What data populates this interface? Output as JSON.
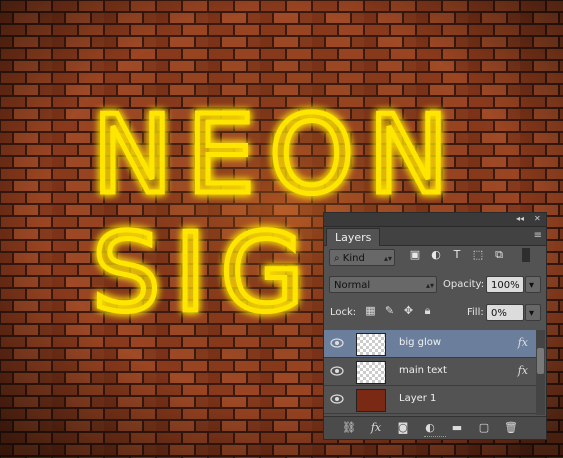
{
  "canvas": {
    "neon_line1": "NEON",
    "neon_line2": "SIG",
    "neon_color": "#ffe600",
    "brick_color": "#8a3a1c",
    "mortar_color": "#3a1a10"
  },
  "panel": {
    "title": "Layers",
    "collapse_icon": "collapse-icon",
    "close_icon": "close-icon",
    "menu_icon": "panel-menu-icon",
    "filter": {
      "kind_label": "Kind",
      "filter_icons": [
        "image-filter-icon",
        "adjustment-filter-icon",
        "type-filter-icon",
        "shape-filter-icon",
        "smart-object-filter-icon"
      ]
    },
    "blend_mode": "Normal",
    "opacity_label": "Opacity:",
    "opacity_value": "100%",
    "lock_label": "Lock:",
    "fill_label": "Fill:",
    "fill_value": "0%",
    "layers": [
      {
        "name": "big glow",
        "selected": true,
        "fx": "fx"
      },
      {
        "name": "main text",
        "selected": false,
        "fx": "fx"
      },
      {
        "name": "Layer 1",
        "selected": false,
        "fx": ""
      }
    ],
    "footer_icons": [
      "link-icon",
      "fx-icon",
      "mask-icon",
      "adjustment-icon",
      "folder-icon",
      "new-layer-icon",
      "trash-icon"
    ],
    "selection_color": "#6b7f9c"
  }
}
